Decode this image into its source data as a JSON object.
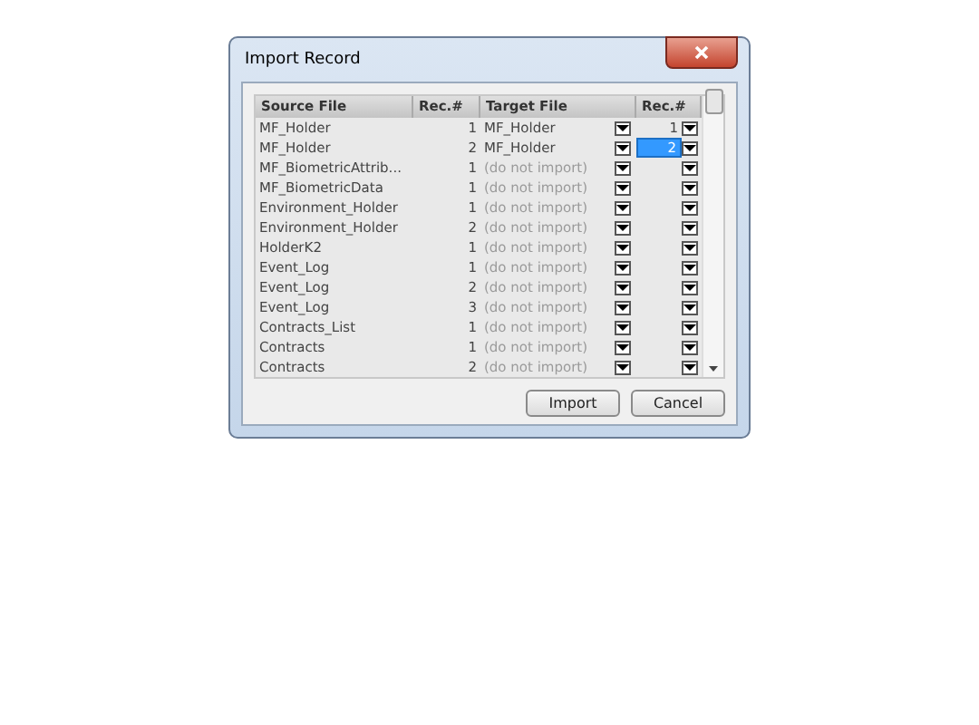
{
  "window": {
    "title": "Import Record"
  },
  "table": {
    "columns": [
      "Source File",
      "Rec.#",
      "Target File",
      "Rec.#"
    ],
    "rows": [
      {
        "source": "MF_Holder",
        "rec": "1",
        "target": "MF_Holder",
        "imported": true,
        "target_rec": "1",
        "selected": false
      },
      {
        "source": "MF_Holder",
        "rec": "2",
        "target": "MF_Holder",
        "imported": true,
        "target_rec": "2",
        "selected": true
      },
      {
        "source": "MF_BiometricAttrib...",
        "rec": "1",
        "target": "(do not import)",
        "imported": false,
        "selected": false
      },
      {
        "source": "MF_BiometricData",
        "rec": "1",
        "target": "(do not import)",
        "imported": false,
        "selected": false
      },
      {
        "source": "Environment_Holder",
        "rec": "1",
        "target": "(do not import)",
        "imported": false,
        "selected": false
      },
      {
        "source": "Environment_Holder",
        "rec": "2",
        "target": "(do not import)",
        "imported": false,
        "selected": false
      },
      {
        "source": "HolderK2",
        "rec": "1",
        "target": "(do not import)",
        "imported": false,
        "selected": false
      },
      {
        "source": "Event_Log",
        "rec": "1",
        "target": "(do not import)",
        "imported": false,
        "selected": false
      },
      {
        "source": "Event_Log",
        "rec": "2",
        "target": "(do not import)",
        "imported": false,
        "selected": false
      },
      {
        "source": "Event_Log",
        "rec": "3",
        "target": "(do not import)",
        "imported": false,
        "selected": false
      },
      {
        "source": "Contracts_List",
        "rec": "1",
        "target": "(do not import)",
        "imported": false,
        "selected": false
      },
      {
        "source": "Contracts",
        "rec": "1",
        "target": "(do not import)",
        "imported": false,
        "selected": false
      },
      {
        "source": "Contracts",
        "rec": "2",
        "target": "(do not import)",
        "imported": false,
        "selected": false
      }
    ]
  },
  "buttons": [
    "Import",
    "Cancel"
  ]
}
